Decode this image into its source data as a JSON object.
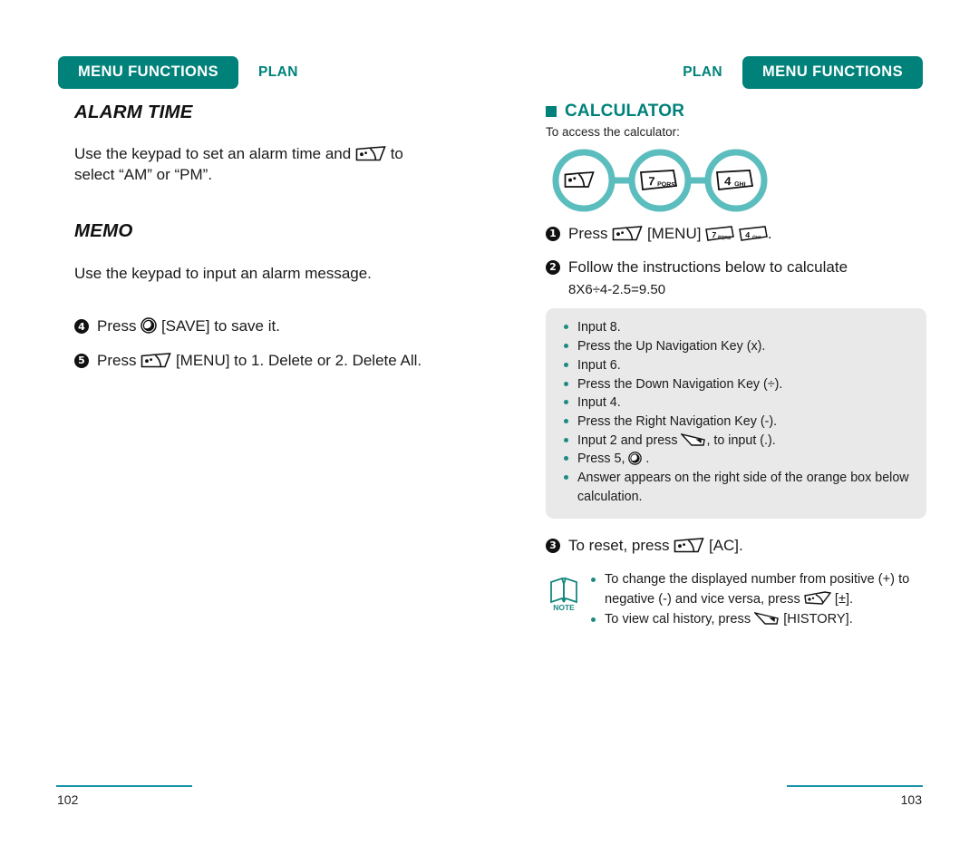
{
  "left_page": {
    "header": {
      "tag": "MENU FUNCTIONS",
      "plan": "PLAN"
    },
    "sections": [
      {
        "title": "ALARM TIME",
        "paragraph_before_key": "Use the keypad to set an alarm time and",
        "paragraph_after_key": "to",
        "paragraph_line2": "select “AM” or “PM”."
      },
      {
        "title": "MEMO",
        "paragraph": "Use the keypad to input an alarm message."
      }
    ],
    "steps": [
      {
        "num": "4",
        "before_key": "Press",
        "key": "soft-key-icon",
        "after_key": "[SAVE] to save it."
      },
      {
        "num": "5",
        "before_key": "Press",
        "key": "menu-key-icon",
        "after_key": "[MENU] to 1. Delete or 2. Delete All."
      }
    ],
    "footer": {
      "page_number": "102"
    }
  },
  "right_page": {
    "header": {
      "plan": "PLAN",
      "tag": "MENU FUNCTIONS"
    },
    "heading": "CALCULATOR",
    "intro": "To access the calculator:",
    "key_sequence": [
      {
        "name": "menu-key-icon",
        "label": ""
      },
      {
        "name": "digit-7-key-icon",
        "label": "7",
        "sublabel": "PQRS"
      },
      {
        "name": "digit-4-key-icon",
        "label": "4",
        "sublabel": "GHI"
      }
    ],
    "steps": [
      {
        "num": "1",
        "text_before": "Press",
        "text_mid": "[MENU]",
        "text_after": "."
      },
      {
        "num": "2",
        "line1": "Follow the instructions below to calculate",
        "line2": "8X6÷4-2.5=9.50"
      },
      {
        "num": "3",
        "text_before": "To reset, press",
        "text_after": "[AC]."
      }
    ],
    "instruction_bullets": [
      "Input 8.",
      "Press the Up Navigation Key (x).",
      "Input 6.",
      "Press the Down Navigation Key (÷).",
      "Input 4.",
      "Press the Right Navigation Key (-).",
      "Input 2 and press  , to input (.).",
      "Press 5,  .",
      "Answer appears on the right side of the orange box below calculation."
    ],
    "note": {
      "icon_label": "NOTE",
      "bullets": [
        {
          "part1": "To change the displayed number from positive (+) to",
          "part2": "negative (-) and vice versa, press",
          "part3": "[±]."
        },
        {
          "part1": "To view cal history, press",
          "part3": "[HISTORY]."
        }
      ]
    },
    "footer": {
      "page_number": "103"
    }
  },
  "colors": {
    "teal": "#00817a",
    "light_teal": "#5bbdbd",
    "rule": "#1a93a8",
    "graybox": "#e9e9e9",
    "bullet": "#1b8b80"
  }
}
